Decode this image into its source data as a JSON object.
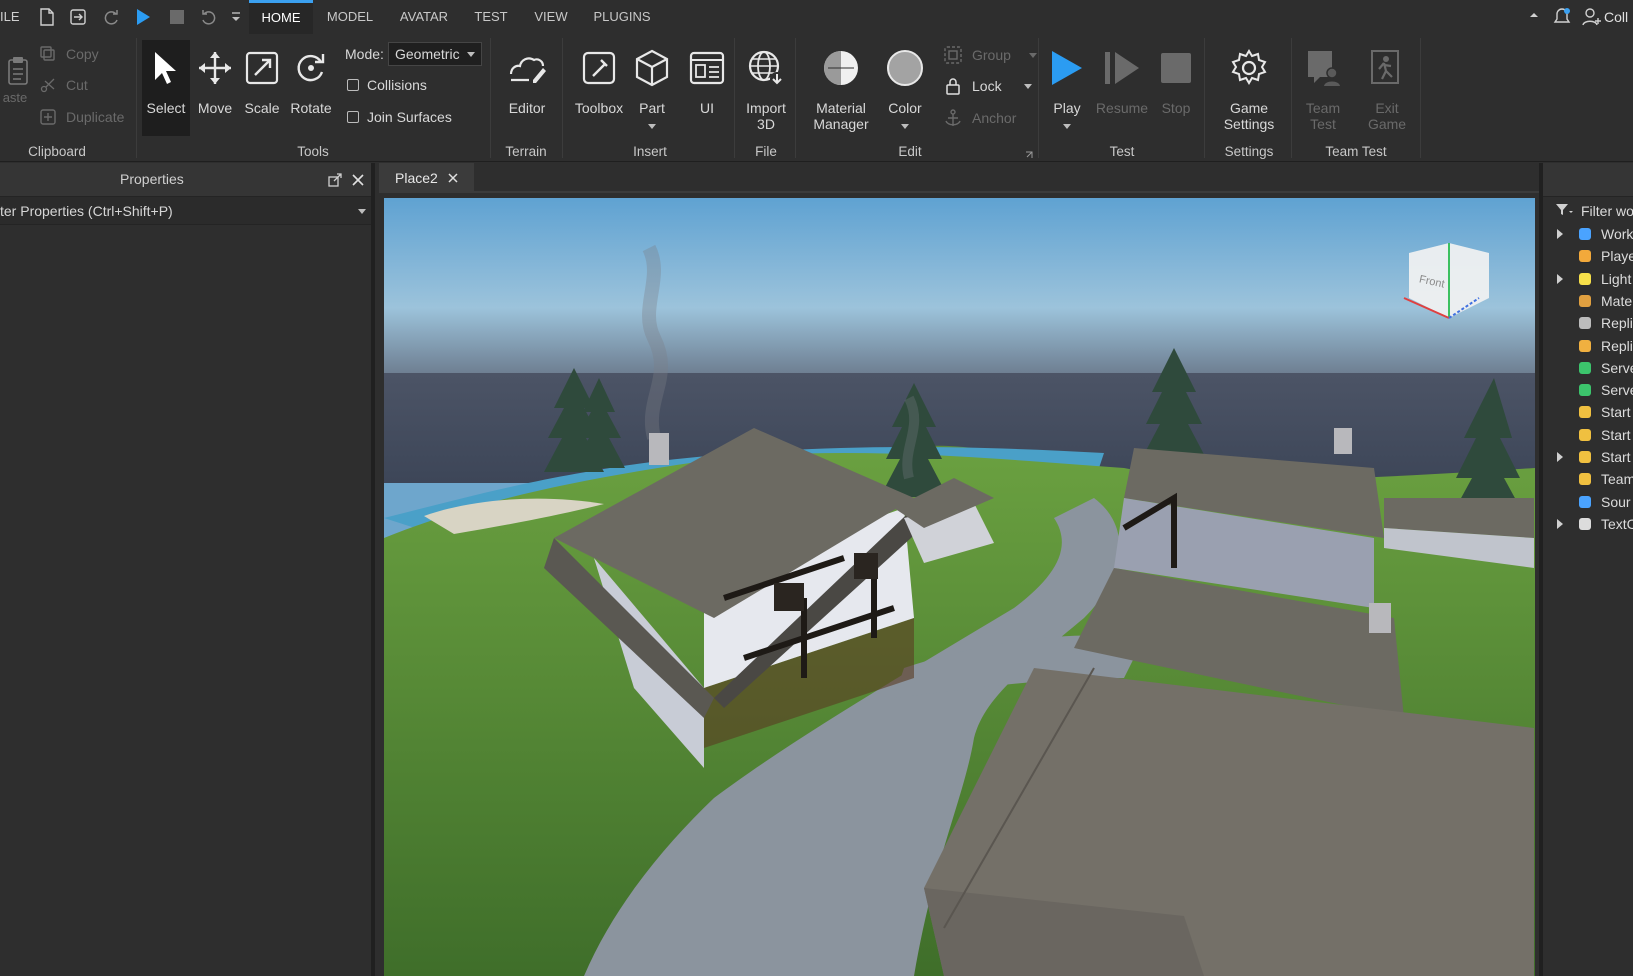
{
  "menubar": {
    "file_label": "ILE",
    "tabs": [
      "HOME",
      "MODEL",
      "AVATAR",
      "TEST",
      "VIEW",
      "PLUGINS"
    ],
    "right_label": "Coll"
  },
  "ribbon": {
    "clipboard": {
      "paste": "aste",
      "copy": "Copy",
      "cut": "Cut",
      "duplicate": "Duplicate",
      "label": "Clipboard"
    },
    "tools": {
      "select": "Select",
      "move": "Move",
      "scale": "Scale",
      "rotate": "Rotate",
      "mode_label": "Mode:",
      "mode_value": "Geometric",
      "collisions": "Collisions",
      "join_surfaces": "Join Surfaces",
      "label": "Tools"
    },
    "terrain": {
      "editor": "Editor",
      "label": "Terrain"
    },
    "insert": {
      "toolbox": "Toolbox",
      "part": "Part",
      "ui": "UI",
      "label": "Insert"
    },
    "file": {
      "import_line1": "Import",
      "import_line2": "3D",
      "label": "File"
    },
    "edit": {
      "material_line1": "Material",
      "material_line2": "Manager",
      "color": "Color",
      "group": "Group",
      "lock": "Lock",
      "anchor": "Anchor",
      "label": "Edit"
    },
    "test": {
      "play": "Play",
      "resume": "Resume",
      "stop": "Stop",
      "label": "Test"
    },
    "settings": {
      "game_line1": "Game",
      "game_line2": "Settings",
      "label": "Settings"
    },
    "team_test": {
      "team_line1": "Team",
      "team_line2": "Test",
      "exit_line1": "Exit",
      "exit_line2": "Game",
      "label": "Team Test"
    }
  },
  "properties": {
    "title": "Properties",
    "filter_text": "ter Properties (Ctrl+Shift+P)"
  },
  "viewport": {
    "tab_label": "Place2",
    "cube_face": "Front"
  },
  "explorer": {
    "filter": "Filter wo",
    "items": [
      {
        "label": "Work",
        "expandable": true,
        "icon": "workspace-icon",
        "color": "#4aa3ff"
      },
      {
        "label": "Playe",
        "expandable": false,
        "icon": "players-icon",
        "color": "#f2a93b"
      },
      {
        "label": "Light",
        "expandable": true,
        "icon": "lighting-icon",
        "color": "#f7e04a"
      },
      {
        "label": "Mate",
        "expandable": false,
        "icon": "material-service-icon",
        "color": "#e0a040"
      },
      {
        "label": "Repli",
        "expandable": false,
        "icon": "replicated-first-icon",
        "color": "#bcbcbc"
      },
      {
        "label": "Repli",
        "expandable": false,
        "icon": "replicated-storage-icon",
        "color": "#f0b040"
      },
      {
        "label": "Serve",
        "expandable": false,
        "icon": "server-script-service-icon",
        "color": "#3cc46c"
      },
      {
        "label": "Serve",
        "expandable": false,
        "icon": "server-storage-icon",
        "color": "#3cc46c"
      },
      {
        "label": "Start",
        "expandable": false,
        "icon": "starter-gui-icon",
        "color": "#f0c040"
      },
      {
        "label": "Start",
        "expandable": false,
        "icon": "starter-pack-icon",
        "color": "#f0c040"
      },
      {
        "label": "Start",
        "expandable": true,
        "icon": "starter-player-icon",
        "color": "#f0c040"
      },
      {
        "label": "Team",
        "expandable": false,
        "icon": "teams-icon",
        "color": "#f0c040"
      },
      {
        "label": "Sour",
        "expandable": false,
        "icon": "sound-service-icon",
        "color": "#4aa3ff"
      },
      {
        "label": "TextC",
        "expandable": true,
        "icon": "text-chat-service-icon",
        "color": "#dcdcdc"
      }
    ]
  },
  "colors": {
    "accent": "#3ba0f0",
    "play": "#2b9cf2"
  }
}
